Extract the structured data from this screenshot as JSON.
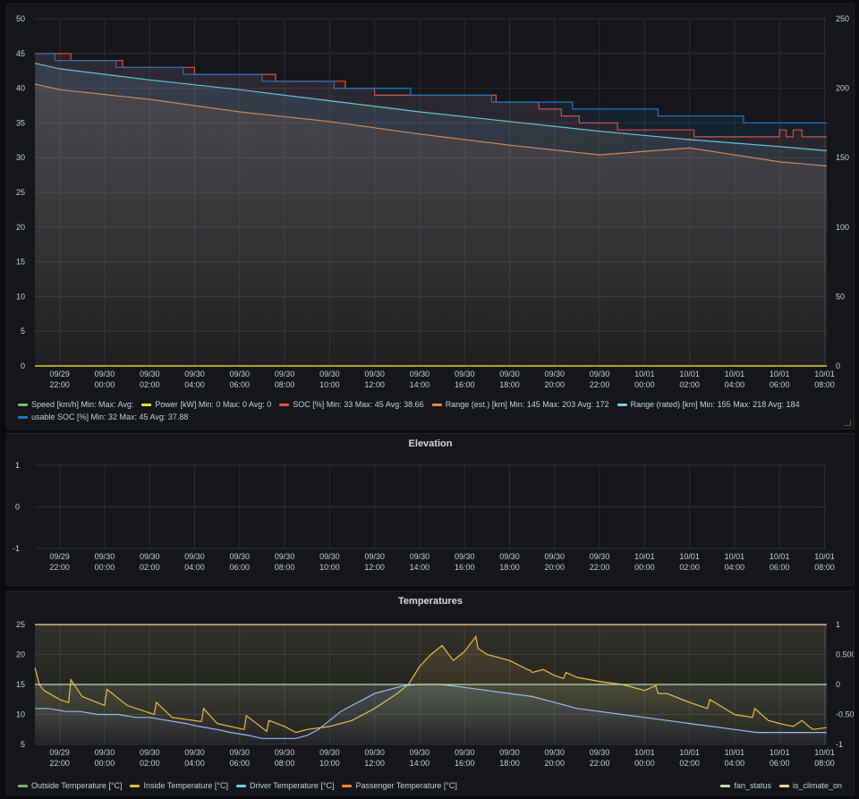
{
  "time_ticks": [
    [
      "09/29",
      "22:00"
    ],
    [
      "09/30",
      "00:00"
    ],
    [
      "09/30",
      "02:00"
    ],
    [
      "09/30",
      "04:00"
    ],
    [
      "09/30",
      "06:00"
    ],
    [
      "09/30",
      "08:00"
    ],
    [
      "09/30",
      "10:00"
    ],
    [
      "09/30",
      "12:00"
    ],
    [
      "09/30",
      "14:00"
    ],
    [
      "09/30",
      "16:00"
    ],
    [
      "09/30",
      "18:00"
    ],
    [
      "09/30",
      "20:00"
    ],
    [
      "09/30",
      "22:00"
    ],
    [
      "10/01",
      "00:00"
    ],
    [
      "10/01",
      "02:00"
    ],
    [
      "10/01",
      "04:00"
    ],
    [
      "10/01",
      "06:00"
    ],
    [
      "10/01",
      "08:00"
    ]
  ],
  "chart_data": [
    {
      "type": "line",
      "title": "",
      "x_unit": "hours from 09/29 22:00",
      "xlim": [
        -1.1,
        34.1
      ],
      "y_left": [
        0,
        50
      ],
      "y_left_ticks": [
        0,
        5,
        10,
        15,
        20,
        25,
        30,
        35,
        40,
        45,
        50
      ],
      "y_right": [
        0,
        250
      ],
      "y_right_ticks": [
        0,
        50,
        100,
        150,
        200,
        250
      ],
      "grid": true,
      "legend_position": "bottom",
      "series": [
        {
          "name": "Speed [km/h]",
          "stats": "Min:  Max:  Avg:",
          "color": "#73bf69",
          "axis": "left",
          "x": [
            -1.1,
            34.1
          ],
          "y": [
            0,
            0
          ]
        },
        {
          "name": "Power [kW]",
          "stats": "Min: 0  Max: 0  Avg: 0",
          "color": "#fade2a",
          "axis": "left",
          "x": [
            -1.1,
            34.1
          ],
          "y": [
            0,
            0
          ]
        },
        {
          "name": "SOC [%]",
          "stats": "Min: 33  Max: 45  Avg: 38.66",
          "color": "#e24d42",
          "axis": "left",
          "x": [
            -1.1,
            0.5,
            0.5,
            2.8,
            2.8,
            6.0,
            6.0,
            9.6,
            9.6,
            12.7,
            12.7,
            14.0,
            14.0,
            19.4,
            19.4,
            21.3,
            21.3,
            22.3,
            22.3,
            23.1,
            23.1,
            24.8,
            24.8,
            28.2,
            28.2,
            32.0,
            32.0,
            32.3,
            32.3,
            32.6,
            32.6,
            33.0,
            33.0,
            34.1
          ],
          "y": [
            45,
            45,
            44,
            44,
            43,
            43,
            42,
            42,
            41,
            41,
            40,
            40,
            39,
            39,
            38,
            38,
            37,
            37,
            36,
            36,
            35,
            35,
            34,
            34,
            33,
            33,
            34,
            34,
            33,
            33,
            34,
            34,
            33,
            33
          ]
        },
        {
          "name": "Range (est.) [km]",
          "stats": "Min: 145  Max: 203  Avg: 172",
          "color": "#ef843c",
          "axis": "right",
          "x": [
            -1.1,
            0,
            4,
            8,
            12,
            16,
            20,
            24,
            28,
            32,
            34.1
          ],
          "y": [
            203,
            199,
            192,
            183,
            176,
            167,
            159,
            152,
            157,
            147,
            144
          ]
        },
        {
          "name": "Range (rated) [km]",
          "stats": "Min: 155  Max: 218  Avg: 184",
          "color": "#6ed0e0",
          "axis": "right",
          "x": [
            -1.1,
            0,
            4,
            8,
            12,
            16,
            20,
            24,
            28,
            32,
            34.1
          ],
          "y": [
            218,
            214,
            206,
            199,
            191,
            183,
            176,
            169,
            163,
            158,
            155
          ]
        },
        {
          "name": "usable SOC [%]",
          "stats": "Min: 32  Max: 45  Avg: 37.88",
          "color": "#1f78c1",
          "axis": "left",
          "x": [
            -1.1,
            -0.2,
            -0.2,
            2.5,
            2.5,
            5.5,
            5.5,
            9.0,
            9.0,
            12.2,
            12.2,
            15.6,
            15.6,
            19.2,
            19.2,
            22.8,
            22.8,
            26.6,
            26.6,
            30.4,
            30.4,
            34.1
          ],
          "y": [
            45,
            45,
            44,
            44,
            43,
            43,
            42,
            42,
            41,
            41,
            40,
            40,
            39,
            39,
            38,
            38,
            37,
            37,
            36,
            36,
            35,
            35
          ]
        }
      ]
    },
    {
      "type": "line",
      "title": "Elevation",
      "xlim": [
        -1.1,
        34.1
      ],
      "y_left": [
        -1,
        1
      ],
      "y_left_ticks": [
        -1,
        0,
        1
      ],
      "grid": true,
      "series": []
    },
    {
      "type": "line",
      "title": "Temperatures",
      "xlim": [
        -1.1,
        34.1
      ],
      "y_left": [
        5,
        25
      ],
      "y_left_ticks": [
        5,
        10,
        15,
        20,
        25
      ],
      "y_right": [
        -1,
        1
      ],
      "y_right_ticks": [
        -1,
        -0.5,
        0,
        0.5,
        1
      ],
      "y_right_tick_labels": [
        "-1",
        "-0.50",
        "0",
        "0.500",
        "1"
      ],
      "grid": true,
      "legend_position": "bottom",
      "series": [
        {
          "name": "Outside Temperature [°C]",
          "color": "#7eb26d",
          "axis": "left",
          "x": [],
          "y": []
        },
        {
          "name": "Inside Temperature [°C]",
          "color": "#eab839",
          "axis": "left",
          "x": [
            -1.1,
            -0.9,
            -0.7,
            0,
            0.4,
            0.5,
            1,
            2,
            2.1,
            3,
            4.2,
            4.3,
            5,
            6.3,
            6.4,
            7,
            8.2,
            8.3,
            9.2,
            9.3,
            10,
            10.5,
            11,
            12,
            13,
            14,
            15,
            15.5,
            16,
            16.5,
            17,
            17.5,
            18,
            18.5,
            18.6,
            19,
            20,
            20.8,
            20.9,
            21,
            21.5,
            22,
            22.4,
            22.5,
            23,
            24,
            25,
            26,
            26.5,
            26.6,
            27,
            28,
            28.8,
            28.9,
            30,
            30.8,
            30.9,
            31.5,
            32,
            32.6,
            32.8,
            33,
            33.3,
            33.5,
            34.1
          ],
          "y": [
            17.8,
            15,
            14,
            12.5,
            12,
            15.8,
            13,
            11.5,
            14.2,
            11.5,
            10,
            12,
            9.5,
            8.8,
            11,
            8.5,
            7.5,
            9.8,
            7.2,
            9,
            8,
            7,
            7.5,
            8,
            9,
            11,
            13.5,
            15,
            18,
            20,
            21.5,
            19,
            20.5,
            23,
            21,
            20,
            19,
            17.5,
            17.4,
            17,
            17.5,
            16.5,
            16,
            17,
            16.2,
            15.5,
            15,
            14,
            14.8,
            13.5,
            13.5,
            12,
            11,
            12.5,
            10,
            9.5,
            11,
            9,
            8.5,
            8,
            8.5,
            9,
            8,
            7.5,
            7.8
          ]
        },
        {
          "name": "Driver Temperature [°C]",
          "color": "#6ed0e0",
          "axis": "left",
          "x": [],
          "y": []
        },
        {
          "name": "Passenger Temperature [°C]",
          "color": "#ef843c",
          "axis": "left",
          "x": [],
          "y": []
        },
        {
          "name": "",
          "color": "#8ab8ff",
          "axis": "left",
          "legend": false,
          "x": [
            -1.1,
            -0.5,
            0.3,
            0.9,
            1.7,
            2.6,
            3.4,
            4.0,
            4.8,
            5.6,
            6.2,
            7.0,
            7.6,
            8.4,
            9.0,
            9.5,
            10,
            10.5,
            11,
            11.5,
            12,
            12.5,
            13,
            13.5,
            14,
            14.5,
            15,
            15.3,
            16,
            17,
            18,
            19,
            20,
            21,
            22,
            23,
            24,
            25,
            26,
            27,
            28,
            29,
            30,
            31,
            32,
            33,
            33.5,
            34.1
          ],
          "y": [
            11,
            11,
            10.5,
            10.5,
            10,
            10,
            9.5,
            9.5,
            9,
            8.5,
            8,
            7.5,
            7,
            6.5,
            6,
            6,
            6,
            6,
            6.5,
            7.5,
            9,
            10.5,
            11.5,
            12.5,
            13.5,
            14,
            14.5,
            14.8,
            15,
            15,
            14.5,
            14,
            13.5,
            13,
            12,
            11,
            10.5,
            10,
            9.5,
            9,
            8.5,
            8,
            7.5,
            7,
            7,
            7,
            7,
            7
          ]
        },
        {
          "name": "fan_status",
          "color": "#b7dbab",
          "axis": "right",
          "x": [
            -1.1,
            34.1
          ],
          "y": [
            0,
            0
          ]
        },
        {
          "name": "is_climate_on",
          "color": "#f4d598",
          "axis": "right",
          "x": [
            -1.1,
            34.1
          ],
          "y": [
            1,
            1
          ]
        }
      ]
    }
  ]
}
